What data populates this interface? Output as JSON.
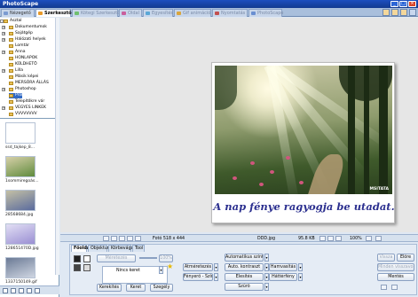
{
  "app": {
    "title": "PhotoScape"
  },
  "tabs": [
    {
      "label": "Nézegető",
      "color": "#7b9bd1",
      "state": "normal"
    },
    {
      "label": "Szerkesztő",
      "color": "#e89a2a",
      "state": "active"
    },
    {
      "label": "Kötegi Szerkesztő",
      "color": "#6fbf6f",
      "state": "dim"
    },
    {
      "label": "Oldal",
      "color": "#c95f9c",
      "state": "dim"
    },
    {
      "label": "Egyesítés",
      "color": "#5aa7d6",
      "state": "dim"
    },
    {
      "label": "Gif animáció",
      "color": "#d9a53d",
      "state": "dim"
    },
    {
      "label": "Nyomtatás",
      "color": "#c25050",
      "state": "dim"
    },
    {
      "label": "PhotoScape",
      "color": "#6a8fd1",
      "state": "dim"
    }
  ],
  "tree": [
    {
      "label": "Asztal",
      "level": 0,
      "expander": "-"
    },
    {
      "label": "Dokumentumok",
      "level": 1,
      "expander": "+"
    },
    {
      "label": "Sajátgép",
      "level": 1,
      "expander": "+"
    },
    {
      "label": "Hálózati helyek",
      "level": 1,
      "expander": "+"
    },
    {
      "label": "Lomtár",
      "level": 1,
      "expander": ""
    },
    {
      "label": "Anna",
      "level": 1,
      "expander": "+"
    },
    {
      "label": "HONLAPOK",
      "level": 1,
      "expander": ""
    },
    {
      "label": "KÜLDHETŐ",
      "level": 1,
      "expander": ""
    },
    {
      "label": "Lilla",
      "level": 1,
      "expander": "+"
    },
    {
      "label": "Másik képei",
      "level": 1,
      "expander": ""
    },
    {
      "label": "MERSÓRA ÁLLÁS",
      "level": 1,
      "expander": ""
    },
    {
      "label": "Photoshop",
      "level": 1,
      "expander": "+"
    },
    {
      "label": "Próba",
      "level": 1,
      "expander": "",
      "selected": true
    },
    {
      "label": "Telepítőkre vár",
      "level": 1,
      "expander": ""
    },
    {
      "label": "VEGYES LINKEK",
      "level": 1,
      "expander": "+"
    },
    {
      "label": "VVVVVVVV",
      "level": 1,
      "expander": ""
    }
  ],
  "thumbnails": [
    {
      "name": "ssd_tajkep_8...",
      "colors": [
        "#ffffff",
        "#ffffff"
      ]
    },
    {
      "name": "1sommiregoás...",
      "colors": [
        "#5f8b3d",
        "#d7d0a9"
      ]
    },
    {
      "name": "28568684.jpg",
      "colors": [
        "#5a6b9e",
        "#c4c0a5"
      ]
    },
    {
      "name": "128651470D.jpg",
      "colors": [
        "#9a8fd3",
        "#e2dff4"
      ]
    },
    {
      "name": "1337150149.gif",
      "colors": [
        "#cfd6e2",
        "#6b7a95"
      ]
    }
  ],
  "photo": {
    "caption": "A nap fénye ragyogja be utadat.",
    "watermark": "MSITATA"
  },
  "statusbar": {
    "dimensions": "Fotó 518 x 444",
    "filename": "DDD.jpg",
    "filesize": "95.8 KB",
    "zoom": "100%"
  },
  "tools": {
    "tabs": [
      "Főoldal",
      "Objektum",
      "Körbevágás",
      "Tool"
    ],
    "active_tab": "Főoldal",
    "frame_label": "Nincs keret",
    "buttons_left": [
      "Kerekítés",
      "Keret",
      "Szegély"
    ],
    "disabled_top": [
      "Méretezés",
      "100%"
    ],
    "adjust": [
      [
        "Átméretezés",
        "Automatikus szint",
        "Hamvasítás"
      ],
      [
        "Fényerő - Szín",
        "Auto. kontraszt",
        "Háttérfény"
      ],
      [
        "",
        "Élesítés",
        ""
      ],
      [
        "",
        "Szűrő",
        ""
      ]
    ],
    "right_buttons": {
      "undo": "Vissza",
      "redo": "Előre",
      "reset": "Minden visszavonása",
      "save": "Mentés"
    }
  }
}
